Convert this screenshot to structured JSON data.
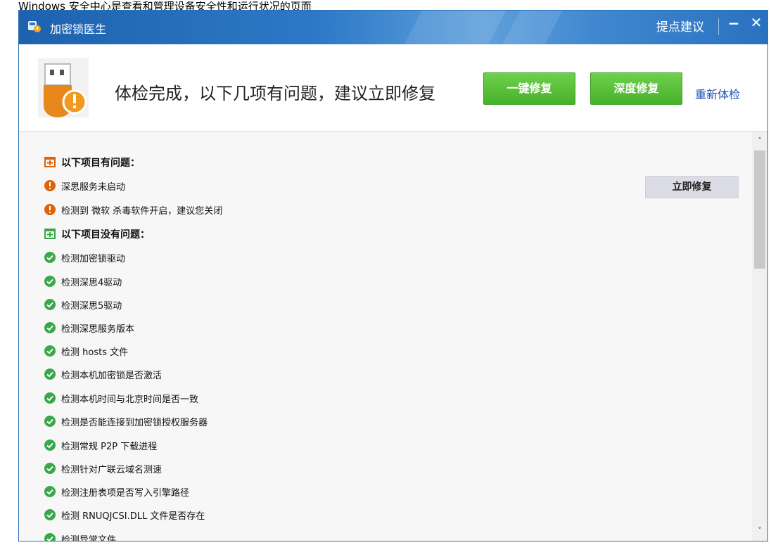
{
  "caption": "Windows 安全中心是查看和管理设备安全性和运行状况的页面",
  "window": {
    "title": "加密锁医生",
    "feedback": "提点建议",
    "minimize": "−",
    "close": "✕"
  },
  "banner": {
    "headline": "体检完成，以下几项有问题，建议立即修复",
    "onekey_fix": "一键修复",
    "deep_fix": "深度修复",
    "recheck": "重新体检"
  },
  "list": {
    "problems_header": "以下项目有问题：",
    "problems": [
      {
        "text": "深思服务未启动",
        "action": "立即修复"
      },
      {
        "text": "检测到 微软 杀毒软件开启，建议您关闭"
      }
    ],
    "ok_header": "以下项目没有问题：",
    "ok_items": [
      "检测加密锁驱动",
      "检测深思4驱动",
      "检测深思5驱动",
      "检测深思服务版本",
      "检测 hosts 文件",
      "检测本机加密锁是否激活",
      "检测本机时间与北京时间是否一致",
      "检测是否能连接到加密锁授权服务器",
      "检测常规 P2P 下载进程",
      "检测针对广联云域名测速",
      "检测注册表项是否写入引擎路径",
      "检测 RNUQJCSI.DLL 文件是否存在",
      "检测异常文件"
    ]
  },
  "scrollbar": {
    "up": "˄",
    "down": "˅"
  },
  "colors": {
    "warning": "#e0620a",
    "ok": "#3aa84a",
    "header_icon": "#e0620a",
    "ok_header_icon": "#3aa84a"
  }
}
